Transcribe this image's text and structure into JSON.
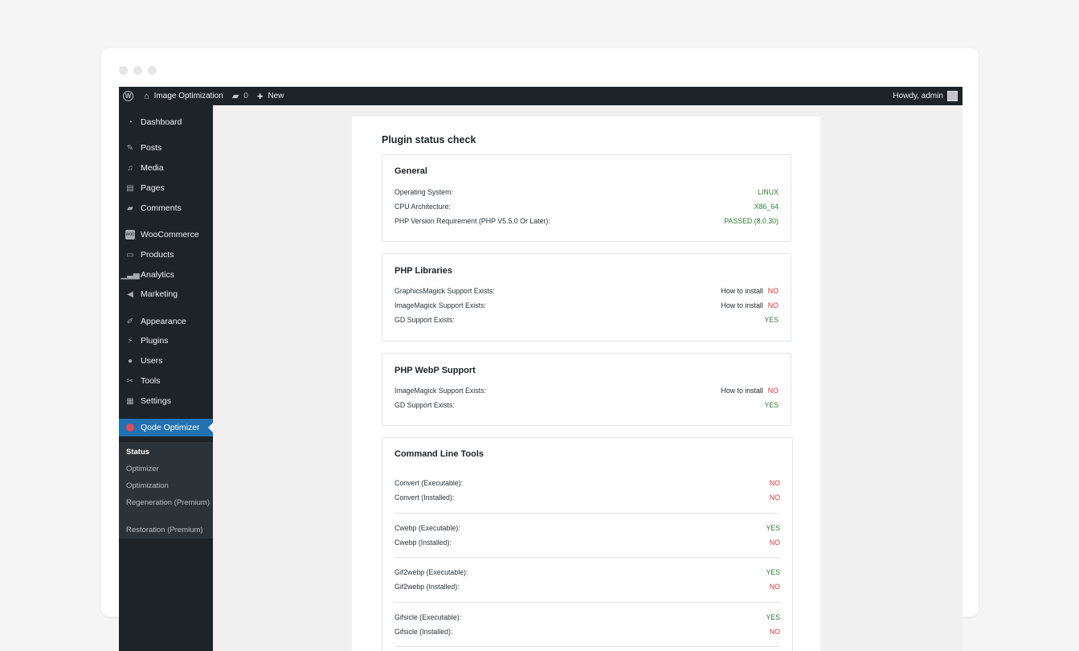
{
  "adminbar": {
    "site_name": "Image Optimization",
    "comments_count": "0",
    "new_label": "New",
    "howdy": "Howdy, admin"
  },
  "sidebar": {
    "items": [
      {
        "label": "Dashboard",
        "icon": "dashboard-icon"
      },
      {
        "label": "Posts",
        "icon": "pin-icon"
      },
      {
        "label": "Media",
        "icon": "media-icon"
      },
      {
        "label": "Pages",
        "icon": "pages-icon"
      },
      {
        "label": "Comments",
        "icon": "comment-icon"
      },
      {
        "label": "WooCommerce",
        "icon": "woo-icon"
      },
      {
        "label": "Products",
        "icon": "archive-icon"
      },
      {
        "label": "Analytics",
        "icon": "bar-chart-icon"
      },
      {
        "label": "Marketing",
        "icon": "megaphone-icon"
      },
      {
        "label": "Appearance",
        "icon": "brush-icon"
      },
      {
        "label": "Plugins",
        "icon": "plug-icon"
      },
      {
        "label": "Users",
        "icon": "user-icon"
      },
      {
        "label": "Tools",
        "icon": "wrench-icon"
      },
      {
        "label": "Settings",
        "icon": "settings-icon"
      },
      {
        "label": "Qode Optimizer",
        "icon": "qode-icon"
      }
    ],
    "submenu": [
      "Status",
      "Optimizer",
      "Optimization",
      "Regeneration (Premium)",
      "Restoration (Premium)"
    ]
  },
  "main": {
    "title": "Plugin status check",
    "general": {
      "title": "General",
      "rows": [
        {
          "label": "Operating System:",
          "value": "LINUX"
        },
        {
          "label": "CPU Architecture:",
          "value": "X86_64"
        },
        {
          "label": "PHP Version Requirement (PHP V5.5.0 Or Later):",
          "value": "PASSED (8.0.30)"
        }
      ]
    },
    "php_libraries": {
      "title": "PHP Libraries",
      "rows": [
        {
          "label": "GraphicsMagick Support Exists:",
          "install": "How to install",
          "value": "NO"
        },
        {
          "label": "ImageMagick Support Exists:",
          "install": "How to install",
          "value": "NO"
        },
        {
          "label": "GD Support Exists:",
          "value": "YES"
        }
      ]
    },
    "webp": {
      "title": "PHP WebP Support",
      "rows": [
        {
          "label": "ImageMagick Support Exists:",
          "install": "How to install",
          "value": "NO"
        },
        {
          "label": "GD Support Exists:",
          "value": "YES"
        }
      ]
    },
    "cli": {
      "title": "Command Line Tools",
      "rows": [
        {
          "label": "Convert (Executable):",
          "value": "NO"
        },
        {
          "label": "Convert (Installed):",
          "value": "NO"
        },
        {
          "label": "Cwebp (Executable):",
          "value": "YES"
        },
        {
          "label": "Cwebp (Installed):",
          "value": "NO"
        },
        {
          "label": "Gif2webp (Executable):",
          "value": "YES"
        },
        {
          "label": "Gif2webp (Installed):",
          "value": "NO"
        },
        {
          "label": "Gifsicle (Executable):",
          "value": "YES"
        },
        {
          "label": "Gifsicle (Installed):",
          "value": "NO"
        }
      ]
    }
  },
  "colors": {
    "adminbar_bg": "#1d2327",
    "active_menu": "#2271b1",
    "ok_green": "#2e7d32",
    "fail_red": "#d63638"
  }
}
